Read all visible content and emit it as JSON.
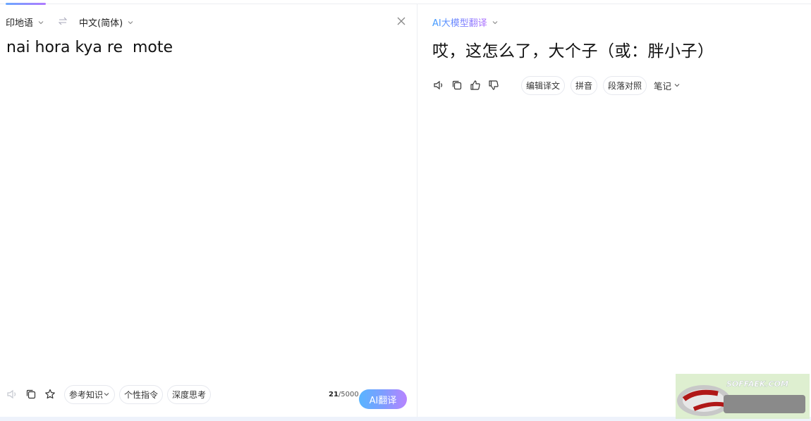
{
  "source": {
    "language": "印地语",
    "text": "nai hora kya re  mote",
    "char_count": "21",
    "char_limit": "/5000",
    "tools": {
      "knowledge_label": "参考知识",
      "instruction_label": "个性指令",
      "deep_think_label": "深度思考",
      "translate_button": "AI翻译"
    }
  },
  "target": {
    "language": "中文(简体)",
    "model": "AI大模型翻译",
    "text": "哎，这怎么了，大个子（或：胖小子）",
    "tools": {
      "edit_label": "编辑译文",
      "pinyin_label": "拼音",
      "paragraph_label": "段落对照",
      "note_label": "笔记"
    }
  },
  "watermark": {
    "text": "SOFFAEK.COM"
  },
  "colors": {
    "accent_start": "#58b5ff",
    "accent_end": "#b784ff",
    "border": "#e6e8ee"
  },
  "icons": {
    "speaker": "speaker-icon",
    "copy": "copy-icon",
    "star": "star-icon",
    "like": "thumbs-up-icon",
    "dislike": "thumbs-down-icon",
    "swap": "swap-icon",
    "close": "close-icon"
  }
}
